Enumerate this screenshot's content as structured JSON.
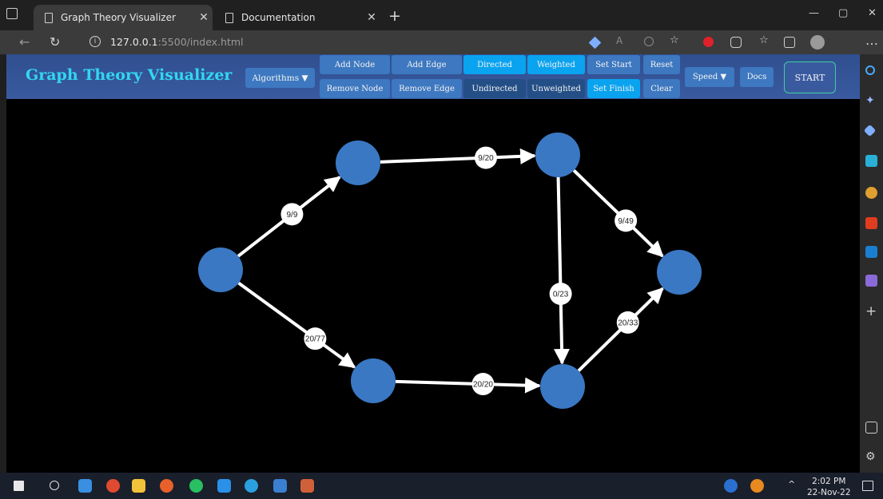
{
  "browser": {
    "tabs": [
      {
        "title": "Graph Theory Visualizer",
        "close": "✕",
        "active": true
      },
      {
        "title": "Documentation",
        "close": "✕",
        "active": false
      }
    ],
    "new_tab": "+",
    "url_host": "127.0.0.1",
    "url_rest": ":5500/index.html",
    "read_aloud": "A",
    "window_controls": {
      "minimize": "—",
      "maximize": "▢",
      "close": "✕"
    },
    "more": "…"
  },
  "app": {
    "title": "Graph Theory Visualizer",
    "buttons": {
      "algorithms": "Algorithms ▼",
      "add_node": "Add Node",
      "remove_node": "Remove Node",
      "add_edge": "Add Edge",
      "remove_edge": "Remove Edge",
      "directed": "Directed",
      "undirected": "Undirected",
      "weighted": "Weighted",
      "unweighted": "Unweighted",
      "set_start": "Set Start",
      "set_finish": "Set Finish",
      "reset": "Reset",
      "clear": "Clear",
      "speed": "Speed ▼",
      "docs": "Docs",
      "start": "START"
    }
  },
  "graph": {
    "colors": {
      "node": "#3a78c4",
      "edge": "#ffffff",
      "label_bg": "#ffffff",
      "label_text": "#222222"
    },
    "edge_labels": [
      "9/9",
      "20/77",
      "9/20",
      "0/23",
      "9/49",
      "20/20",
      "20/33"
    ]
  },
  "taskbar": {
    "time": "2:02 PM",
    "date": "22-Nov-22",
    "chevron": "^"
  }
}
